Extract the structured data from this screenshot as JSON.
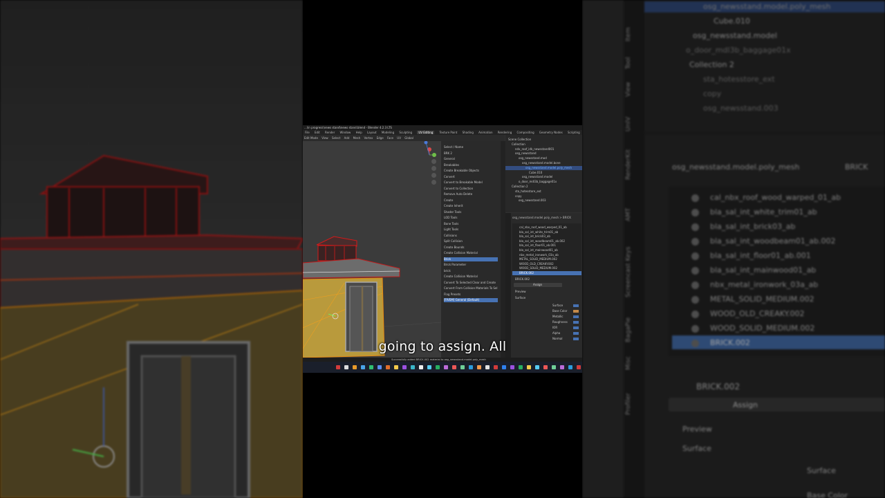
{
  "left_bg": {},
  "right_bg": {
    "object_path": "osg_newsstand.model.poly_mesh",
    "object_path_tail": "BRICK",
    "outliner_rows": [
      "osg_newsstand.model.poly_mesh",
      "Cube.010",
      "osg_newsstand.model",
      "o_door_mdl3b_baggage01x",
      "Collection 2",
      "sta_hotesstore_ext",
      "copy",
      "osg_newsstand.003"
    ],
    "side_tabs": [
      "Item",
      "Tool",
      "View",
      "UnIV",
      "RenderKit",
      "AMT",
      "Screencast Keys",
      "BagaPie",
      "Misc",
      "Profiler"
    ],
    "materials": [
      "cal_nbx_roof_wood_warped_01_ab",
      "bla_sal_int_white_trim01_ab",
      "bla_sal_int_brick03_ab",
      "bla_sal_int_woodbeam01_ab.002",
      "bla_sal_int_floor01_ab.001",
      "bla_sal_int_mainwood01_ab",
      "nbx_metal_ironwork_03a_ab",
      "METAL_SOLID_MEDIUM.002",
      "WOOD_OLD_CREAKY.002",
      "WOOD_SOLID_MEDIUM.002",
      "BRICK.002"
    ],
    "selected_material": "BRICK.002",
    "assign_label": "Assign",
    "preview_label": "Preview",
    "surface_label": "Surface",
    "surface_field": "Surface",
    "base_color_label": "Base Color"
  },
  "blender": {
    "title": "...\\in progress\\news stand\\news stand.blend - Blender 4.2.3 LTS",
    "menus": [
      "File",
      "Edit",
      "Render",
      "Window",
      "Help"
    ],
    "workspaces": [
      "Layout",
      "Modeling",
      "Sculpting",
      "UV Editing",
      "Texture Paint",
      "Shading",
      "Animation",
      "Rendering",
      "Compositing",
      "Geometry Nodes",
      "Scripting"
    ],
    "active_workspace": "UV Editing",
    "viewport_header": [
      "Edit Mode",
      "View",
      "Select",
      "Add",
      "Mesh",
      "Vertex",
      "Edge",
      "Face",
      "UV",
      "Global"
    ],
    "npanel_rows": [
      {
        "label": "Select / Name",
        "hl": false
      },
      {
        "label": "BRK 2",
        "hl": false
      },
      {
        "label": "General",
        "hl": false
      },
      {
        "label": "Breakables",
        "hl": false
      },
      {
        "label": "Create Breakable Objects",
        "hl": false
      },
      {
        "label": "Convert",
        "hl": false
      },
      {
        "label": "Convert to Breakable Model",
        "hl": false
      },
      {
        "label": "Convert to Collection",
        "hl": false
      },
      {
        "label": "Remove   Auto   Delete",
        "hl": false
      },
      {
        "label": "Create",
        "hl": false
      },
      {
        "label": "Create Inherit",
        "hl": false
      },
      {
        "label": "Shader Tools",
        "hl": false
      },
      {
        "label": "LOD Tools",
        "hl": false
      },
      {
        "label": "Bone Tools",
        "hl": false
      },
      {
        "label": "Light Tools",
        "hl": false
      },
      {
        "label": "Collisions",
        "hl": false
      },
      {
        "label": "Split Collision",
        "hl": false
      },
      {
        "label": "Create Bounds",
        "hl": false
      },
      {
        "label": "Create Collision Material",
        "hl": false
      },
      {
        "label": "Brick",
        "hl": true
      },
      {
        "label": "Brick Parameter",
        "hl": false
      },
      {
        "label": "brick",
        "hl": false
      },
      {
        "label": "Create Collision Material",
        "hl": false
      },
      {
        "label": "Convert To Selected   Clear and Create",
        "hl": false
      },
      {
        "label": "Convert From Collision Materials To Sel",
        "hl": false
      },
      {
        "label": "Flag Presets",
        "hl": false
      },
      {
        "label": "[FIVEM] General (Default)",
        "hl": true
      }
    ],
    "outliner_rows": [
      {
        "label": "Scene Collection",
        "indent": 0,
        "sel": false
      },
      {
        "label": "Collection",
        "indent": 1,
        "sel": false
      },
      {
        "label": "ndx_roof_idk_newsstand001",
        "indent": 2,
        "sel": false
      },
      {
        "label": "osg_newsstand",
        "indent": 2,
        "sel": false
      },
      {
        "label": "osg_newsstand.mod",
        "indent": 3,
        "sel": false
      },
      {
        "label": "osg_newsstand.model.bone",
        "indent": 4,
        "sel": false
      },
      {
        "label": "osg_newsstand.model.poly_mesh",
        "indent": 5,
        "sel": true
      },
      {
        "label": "Cube.010",
        "indent": 6,
        "sel": false
      },
      {
        "label": "osg_newsstand.model",
        "indent": 4,
        "sel": false
      },
      {
        "label": "o_door_mdl3b_baggage01x",
        "indent": 3,
        "sel": false
      },
      {
        "label": "Collection 2",
        "indent": 1,
        "sel": false
      },
      {
        "label": "sta_hotesstore_ext",
        "indent": 2,
        "sel": false
      },
      {
        "label": "copy",
        "indent": 2,
        "sel": false
      },
      {
        "label": "osg_newsstand.003",
        "indent": 3,
        "sel": false
      }
    ],
    "props_header": "osg_newsstand.model.poly_mesh  >  BRICK",
    "props_materials": [
      "cal_nbx_roof_wood_warped_01_ab",
      "bla_sal_int_white_trim01_ab",
      "bla_sal_int_brick03_ab",
      "bla_sal_int_woodbeam01_ab.002",
      "bla_sal_int_floor01_ab.001",
      "bla_sal_int_mainwood01_ab",
      "nbx_metal_ironwork_03a_ab",
      "METAL_SOLID_MEDIUM.002",
      "WOOD_OLD_CREAKY.002",
      "WOOD_SOLID_MEDIUM.002",
      "BRICK.002"
    ],
    "props_material_name": "BRICK.002",
    "props_assign": "Assign",
    "props_preview": "Preview",
    "props_surface": "Surface",
    "props_fields": [
      "Surface",
      "Base Color",
      "Metallic",
      "Roughness",
      "IOR",
      "Alpha",
      "Normal"
    ],
    "status": "Successfully added BRICK.002 material to osg_newsstand.model.poly_mesh"
  },
  "caption": "going to assign. All"
}
